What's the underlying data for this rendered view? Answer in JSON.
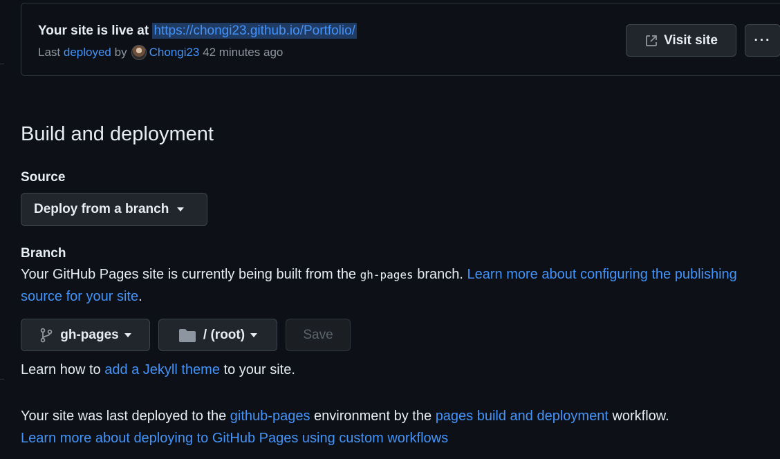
{
  "live_banner": {
    "prefix": "Your site is live at",
    "url": "https://chongi23.github.io/Portfolio/",
    "last_label": "Last",
    "deployed_link": "deployed",
    "by_label": "by",
    "user": "Chongi23",
    "time_ago": "42 minutes ago",
    "visit_button": "Visit site",
    "more_button": "···"
  },
  "build": {
    "heading": "Build and deployment",
    "source_label": "Source",
    "source_dropdown": "Deploy from a branch",
    "branch_label": "Branch",
    "branch_text_1": "Your GitHub Pages site is currently being built from the",
    "branch_code": "gh-pages",
    "branch_text_2": "branch.",
    "branch_link_1": "Learn more about configuring the publishing",
    "branch_link_2": "source for your site",
    "branch_period": ".",
    "branch_select": "gh-pages",
    "folder_select": "/ (root)",
    "save_button": "Save",
    "jekyll_text_1": "Learn how to",
    "jekyll_link": "add a Jekyll theme",
    "jekyll_text_2": "to your site.",
    "deployed_text_1": "Your site was last deployed to the",
    "deployed_env_link": "github-pages",
    "deployed_text_2": "environment by the",
    "deployed_workflow_link": "pages build and deployment",
    "deployed_text_3": "workflow.",
    "custom_workflows_link": "Learn more about deploying to GitHub Pages using custom workflows"
  },
  "colors": {
    "background": "#0d1117",
    "link": "#4493f8",
    "border": "#30363d",
    "button_bg": "#21262d"
  }
}
